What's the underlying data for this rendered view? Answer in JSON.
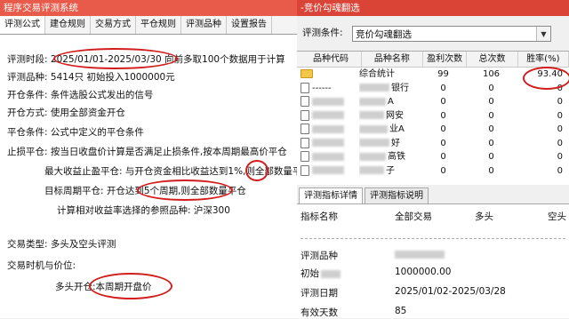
{
  "left_window": {
    "title": "程序交易评测系统",
    "tabs": [
      "评测公式",
      "建仓规则",
      "交易方式",
      "平仓规则",
      "评测品种",
      "设置报告"
    ],
    "report": {
      "period_label": "评测时段:",
      "period_value": "2025/01/01-2025/03/30 向前多取100个数据用于计算",
      "varieties_label": "评测品种:",
      "varieties_value": "5414只 初始投入1000000元",
      "open_cond_label": "开仓条件:",
      "open_cond_value": "条件选股公式发出的信号",
      "open_method_label": "开仓方式:",
      "open_method_value": "使用全部资金开仓",
      "close_cond_label": "平仓条件:",
      "close_cond_value": "公式中定义的平仓条件",
      "stoploss_label": "止损平仓:",
      "stoploss_value": "按当日收盘价计算是否满足止损条件,按本周期最高价平仓",
      "max_profit_label": "最大收益止盈平仓:",
      "max_profit_value": "与开仓资金相比收益达到1%,则全部数量平仓",
      "target_label": "目标周期平仓:",
      "target_value": "开仓达到5个周期,则全部数量平仓",
      "benchmark_text": "计算相对收益率选择的参照品种: 沪深300",
      "trade_type_label": "交易类型:",
      "trade_type_value": "多头及空头评测",
      "trade_timing_label": "交易时机与价位:",
      "trade_timing_value": "多头开仓:本周期开盘价"
    }
  },
  "right_window": {
    "title": "-竞价勾魂翻选",
    "condition_label": "评测条件:",
    "condition_value": "竞价勾魂翻选",
    "table": {
      "headers": [
        "品种代码",
        "品种名称",
        "盈利次数",
        "总次数",
        "胜率(%)"
      ],
      "rows": [
        {
          "code": "",
          "name": "综合统计",
          "wins": "99",
          "total": "106",
          "rate": "93.40"
        },
        {
          "code": "------",
          "name": "银行",
          "wins": "0",
          "total": "0",
          "rate": "0"
        },
        {
          "code": "",
          "name": "A",
          "wins": "0",
          "total": "0",
          "rate": "0"
        },
        {
          "code": "",
          "name": "网安",
          "wins": "0",
          "total": "0",
          "rate": "0"
        },
        {
          "code": "",
          "name": "业A",
          "wins": "0",
          "total": "0",
          "rate": "0"
        },
        {
          "code": "",
          "name": "好",
          "wins": "0",
          "total": "0",
          "rate": "0"
        },
        {
          "code": "",
          "name": "高铁",
          "wins": "0",
          "total": "0",
          "rate": "0"
        },
        {
          "code": "",
          "name": "子",
          "wins": "0",
          "total": "0",
          "rate": "0"
        }
      ]
    },
    "sub_tabs": [
      "评测指标详情",
      "评测指标说明"
    ],
    "stats_headers": [
      "指标名称",
      "全部交易",
      "多头",
      "空头"
    ],
    "stats": [
      {
        "label": "评测品种",
        "value": ""
      },
      {
        "label": "初始",
        "value": "1000000.00"
      },
      {
        "label": "评测日期",
        "value": "2025/01/02-2025/03/28"
      },
      {
        "label": "有效天数",
        "value": "85"
      }
    ]
  },
  "colors": {
    "title_left": "#e85a4a",
    "title_right": "#d94437",
    "annotation": "#d21d1d"
  }
}
